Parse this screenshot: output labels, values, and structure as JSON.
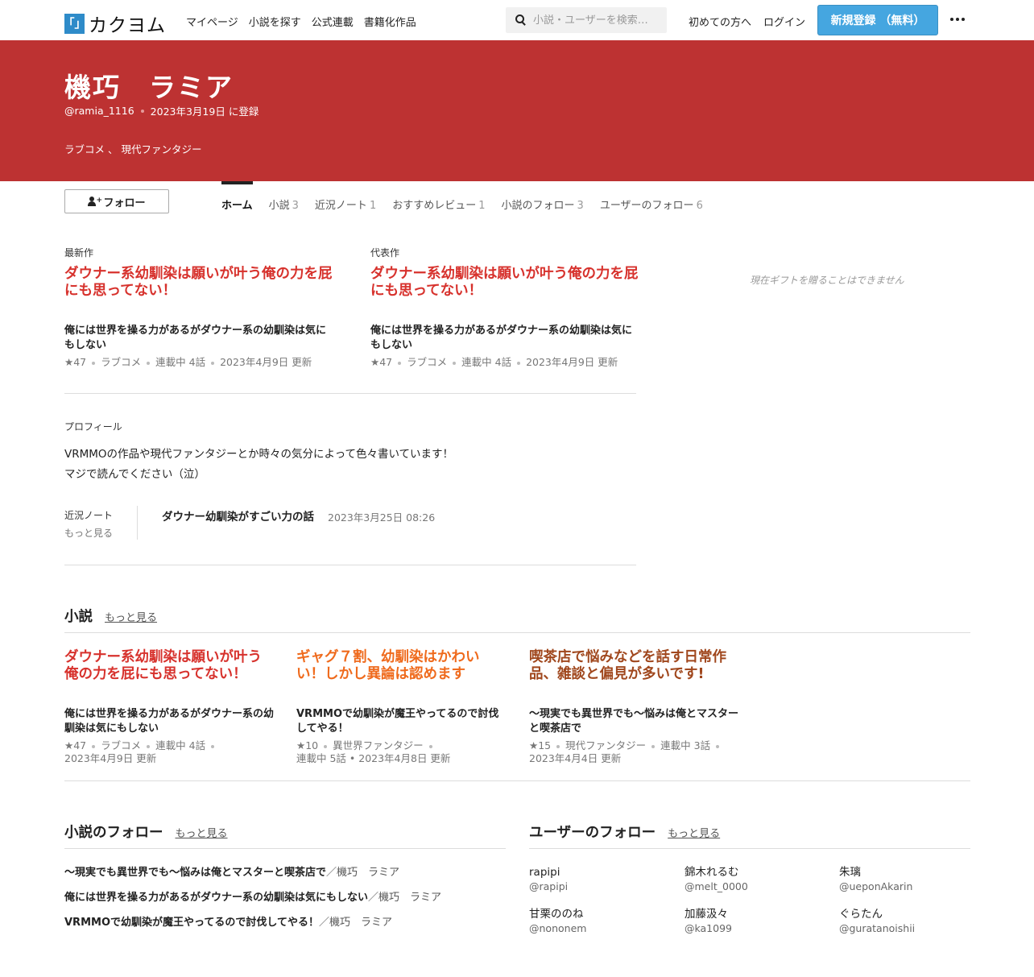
{
  "header": {
    "logo_mark": "「」",
    "logo_text": "カクヨム",
    "nav": [
      "マイページ",
      "小説を探す",
      "公式連載",
      "書籍化作品"
    ],
    "search_placeholder": "小説・ユーザーを検索…",
    "first_time": "初めての方へ",
    "login": "ログイン",
    "signup": "新規登録 （無料）"
  },
  "user": {
    "name": "機巧　ラミア",
    "handle": "@ramia_1116",
    "registered": "2023年3月19日 に登録",
    "genres": "ラブコメ 、 現代ファンタジー"
  },
  "follow_label": "フォロー",
  "tabs": [
    {
      "label": "ホーム",
      "count": ""
    },
    {
      "label": "小説",
      "count": "3"
    },
    {
      "label": "近況ノート",
      "count": "1"
    },
    {
      "label": "おすすめレビュー",
      "count": "1"
    },
    {
      "label": "小説のフォロー",
      "count": "3"
    },
    {
      "label": "ユーザーのフォロー",
      "count": "6"
    }
  ],
  "latest": {
    "label": "最新作",
    "title": "ダウナー系幼馴染は願いが叶う俺の力を屁にも思ってない！",
    "catch": "俺には世界を操る力があるがダウナー系の幼馴染は気にもしない",
    "meta": [
      "★47",
      "ラブコメ",
      "連載中 4話",
      "2023年4月9日 更新"
    ]
  },
  "representative": {
    "label": "代表作",
    "title": "ダウナー系幼馴染は願いが叶う俺の力を屁にも思ってない！",
    "catch": "俺には世界を操る力があるがダウナー系の幼馴染は気にもしない",
    "meta": [
      "★47",
      "ラブコメ",
      "連載中 4話",
      "2023年4月9日 更新"
    ]
  },
  "gift_note": "現在ギフトを贈ることはできません",
  "profile": {
    "label": "プロフィール",
    "lines": [
      "VRMMOの作品や現代ファンタジーとか時々の気分によって色々書いています！",
      "マジで読んでください（泣）"
    ]
  },
  "notes": {
    "label": "近況ノート",
    "more": "もっと見る",
    "title": "ダウナー幼馴染がすごい力の話",
    "date": "2023年3月25日 08:26"
  },
  "novels_section": {
    "title": "小説",
    "more": "もっと見る",
    "items": [
      {
        "title": "ダウナー系幼馴染は願いが叶う俺の力を屁にも思ってない！",
        "color": "#d7322d",
        "catch": "俺には世界を操る力があるがダウナー系の幼馴染は気にもしない",
        "meta1": [
          "★47",
          "ラブコメ",
          "連載中 4話"
        ],
        "meta2": "2023年4月9日 更新"
      },
      {
        "title": "ギャグ７割、幼馴染はかわいい！しかし異論は認めます",
        "color": "#ef6a1c",
        "catch": "VRMMOで幼馴染が魔王やってるので討伐してやる！",
        "meta1": [
          "★10",
          "異世界ファンタジー"
        ],
        "meta2": "連載中 5話 • 2023年4月8日 更新"
      },
      {
        "title": "喫茶店で悩みなどを話す日常作品、雑談と偏見が多いです!",
        "color": "#a0471d",
        "catch": "～現実でも異世界でも～悩みは俺とマスターと喫茶店で",
        "meta1": [
          "★15",
          "現代ファンタジー",
          "連載中 3話"
        ],
        "meta2": "2023年4月4日 更新"
      }
    ]
  },
  "followed_novels": {
    "title": "小説のフォロー",
    "more": "もっと見る",
    "items": [
      {
        "title": "～現実でも異世界でも～悩みは俺とマスターと喫茶店で",
        "author": "／機巧　ラミア"
      },
      {
        "title": "俺には世界を操る力があるがダウナー系の幼馴染は気にもしない",
        "author": "／機巧　ラミア"
      },
      {
        "title": "VRMMOで幼馴染が魔王やってるので討伐してやる！",
        "author": "／機巧　ラミア"
      }
    ]
  },
  "followed_users": {
    "title": "ユーザーのフォロー",
    "more": "もっと見る",
    "items": [
      {
        "name": "rapipi",
        "id": "@rapipi"
      },
      {
        "name": "錦木れるむ",
        "id": "@melt_0000"
      },
      {
        "name": "朱璃",
        "id": "@ueponAkarin"
      },
      {
        "name": "甘栗ののね",
        "id": "@nononem"
      },
      {
        "name": "加藤汲々",
        "id": "@ka1099"
      },
      {
        "name": "ぐらたん",
        "id": "@guratanoishii"
      }
    ]
  }
}
